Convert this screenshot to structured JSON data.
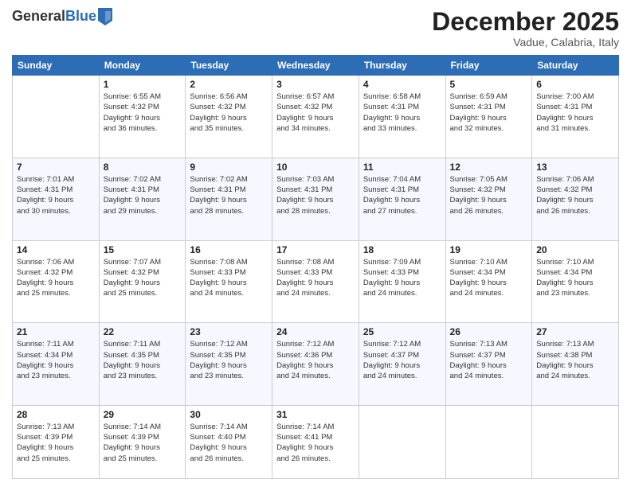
{
  "header": {
    "logo_general": "General",
    "logo_blue": "Blue",
    "title": "December 2025",
    "location": "Vadue, Calabria, Italy"
  },
  "days_of_week": [
    "Sunday",
    "Monday",
    "Tuesday",
    "Wednesday",
    "Thursday",
    "Friday",
    "Saturday"
  ],
  "weeks": [
    [
      {
        "day": "",
        "info": ""
      },
      {
        "day": "1",
        "info": "Sunrise: 6:55 AM\nSunset: 4:32 PM\nDaylight: 9 hours\nand 36 minutes."
      },
      {
        "day": "2",
        "info": "Sunrise: 6:56 AM\nSunset: 4:32 PM\nDaylight: 9 hours\nand 35 minutes."
      },
      {
        "day": "3",
        "info": "Sunrise: 6:57 AM\nSunset: 4:32 PM\nDaylight: 9 hours\nand 34 minutes."
      },
      {
        "day": "4",
        "info": "Sunrise: 6:58 AM\nSunset: 4:31 PM\nDaylight: 9 hours\nand 33 minutes."
      },
      {
        "day": "5",
        "info": "Sunrise: 6:59 AM\nSunset: 4:31 PM\nDaylight: 9 hours\nand 32 minutes."
      },
      {
        "day": "6",
        "info": "Sunrise: 7:00 AM\nSunset: 4:31 PM\nDaylight: 9 hours\nand 31 minutes."
      }
    ],
    [
      {
        "day": "7",
        "info": "Sunrise: 7:01 AM\nSunset: 4:31 PM\nDaylight: 9 hours\nand 30 minutes."
      },
      {
        "day": "8",
        "info": "Sunrise: 7:02 AM\nSunset: 4:31 PM\nDaylight: 9 hours\nand 29 minutes."
      },
      {
        "day": "9",
        "info": "Sunrise: 7:02 AM\nSunset: 4:31 PM\nDaylight: 9 hours\nand 28 minutes."
      },
      {
        "day": "10",
        "info": "Sunrise: 7:03 AM\nSunset: 4:31 PM\nDaylight: 9 hours\nand 28 minutes."
      },
      {
        "day": "11",
        "info": "Sunrise: 7:04 AM\nSunset: 4:31 PM\nDaylight: 9 hours\nand 27 minutes."
      },
      {
        "day": "12",
        "info": "Sunrise: 7:05 AM\nSunset: 4:32 PM\nDaylight: 9 hours\nand 26 minutes."
      },
      {
        "day": "13",
        "info": "Sunrise: 7:06 AM\nSunset: 4:32 PM\nDaylight: 9 hours\nand 26 minutes."
      }
    ],
    [
      {
        "day": "14",
        "info": "Sunrise: 7:06 AM\nSunset: 4:32 PM\nDaylight: 9 hours\nand 25 minutes."
      },
      {
        "day": "15",
        "info": "Sunrise: 7:07 AM\nSunset: 4:32 PM\nDaylight: 9 hours\nand 25 minutes."
      },
      {
        "day": "16",
        "info": "Sunrise: 7:08 AM\nSunset: 4:33 PM\nDaylight: 9 hours\nand 24 minutes."
      },
      {
        "day": "17",
        "info": "Sunrise: 7:08 AM\nSunset: 4:33 PM\nDaylight: 9 hours\nand 24 minutes."
      },
      {
        "day": "18",
        "info": "Sunrise: 7:09 AM\nSunset: 4:33 PM\nDaylight: 9 hours\nand 24 minutes."
      },
      {
        "day": "19",
        "info": "Sunrise: 7:10 AM\nSunset: 4:34 PM\nDaylight: 9 hours\nand 24 minutes."
      },
      {
        "day": "20",
        "info": "Sunrise: 7:10 AM\nSunset: 4:34 PM\nDaylight: 9 hours\nand 23 minutes."
      }
    ],
    [
      {
        "day": "21",
        "info": "Sunrise: 7:11 AM\nSunset: 4:34 PM\nDaylight: 9 hours\nand 23 minutes."
      },
      {
        "day": "22",
        "info": "Sunrise: 7:11 AM\nSunset: 4:35 PM\nDaylight: 9 hours\nand 23 minutes."
      },
      {
        "day": "23",
        "info": "Sunrise: 7:12 AM\nSunset: 4:35 PM\nDaylight: 9 hours\nand 23 minutes."
      },
      {
        "day": "24",
        "info": "Sunrise: 7:12 AM\nSunset: 4:36 PM\nDaylight: 9 hours\nand 24 minutes."
      },
      {
        "day": "25",
        "info": "Sunrise: 7:12 AM\nSunset: 4:37 PM\nDaylight: 9 hours\nand 24 minutes."
      },
      {
        "day": "26",
        "info": "Sunrise: 7:13 AM\nSunset: 4:37 PM\nDaylight: 9 hours\nand 24 minutes."
      },
      {
        "day": "27",
        "info": "Sunrise: 7:13 AM\nSunset: 4:38 PM\nDaylight: 9 hours\nand 24 minutes."
      }
    ],
    [
      {
        "day": "28",
        "info": "Sunrise: 7:13 AM\nSunset: 4:39 PM\nDaylight: 9 hours\nand 25 minutes."
      },
      {
        "day": "29",
        "info": "Sunrise: 7:14 AM\nSunset: 4:39 PM\nDaylight: 9 hours\nand 25 minutes."
      },
      {
        "day": "30",
        "info": "Sunrise: 7:14 AM\nSunset: 4:40 PM\nDaylight: 9 hours\nand 26 minutes."
      },
      {
        "day": "31",
        "info": "Sunrise: 7:14 AM\nSunset: 4:41 PM\nDaylight: 9 hours\nand 26 minutes."
      },
      {
        "day": "",
        "info": ""
      },
      {
        "day": "",
        "info": ""
      },
      {
        "day": "",
        "info": ""
      }
    ]
  ]
}
